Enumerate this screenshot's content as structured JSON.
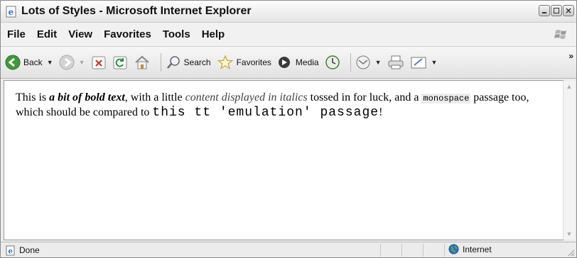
{
  "window": {
    "title": "Lots of Styles - Microsoft Internet Explorer"
  },
  "menu": {
    "items": [
      {
        "label": "File"
      },
      {
        "label": "Edit"
      },
      {
        "label": "View"
      },
      {
        "label": "Favorites"
      },
      {
        "label": "Tools"
      },
      {
        "label": "Help"
      }
    ]
  },
  "toolbar": {
    "back_label": "Back",
    "search_label": "Search",
    "favorites_label": "Favorites",
    "media_label": "Media",
    "chevron": "»",
    "icons": [
      "back-icon",
      "forward-icon",
      "stop-icon",
      "refresh-icon",
      "home-icon",
      "search-icon",
      "favorites-star-icon",
      "media-icon",
      "history-icon",
      "mail-icon",
      "print-icon",
      "edit-icon"
    ]
  },
  "content": {
    "seg1": "This is ",
    "bold_italic": "a bit of bold text",
    "seg2": ", with a little ",
    "italic": "content displayed in italics",
    "seg3": " tossed in for luck, and a ",
    "mono": "monospace",
    "seg4": " passage too, which should be compared to ",
    "tt_emulation": "this tt 'emulation' passage",
    "seg5": "!"
  },
  "status": {
    "left_text": "Done",
    "zone_text": "Internet"
  },
  "colors": {
    "ie_blue": "#2a6fd6",
    "back_green": "#3f9a3a",
    "star_yellow": "#e8b319"
  }
}
